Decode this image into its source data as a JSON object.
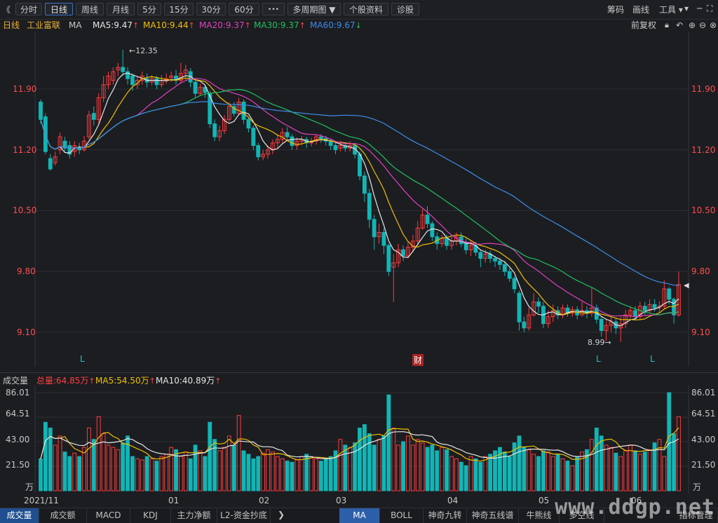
{
  "toolbar": {
    "back_glyph": "《",
    "periods": [
      "分时",
      "日线",
      "周线",
      "月线",
      "5分",
      "15分",
      "30分",
      "60分"
    ],
    "more_label": "•••",
    "multi_period_label": "多周期图 ▼",
    "stock_info_label": "个股资料",
    "diagnose_label": "诊股",
    "chip_label": "筹码",
    "draw_label": "画线",
    "tools_label": "工具 ▾",
    "pin_glyph": "▾",
    "window_glyphs": [
      "─",
      "⛶"
    ]
  },
  "ma_legend": {
    "period": "日线",
    "stock_name": "工业富联",
    "indicator": "MA",
    "items": [
      {
        "label": "MA5:9.47",
        "dir": "↑",
        "color": "#e6e6e6"
      },
      {
        "label": "MA10:9.44",
        "dir": "↑",
        "color": "#f0c000"
      },
      {
        "label": "MA20:9.37",
        "dir": "↑",
        "color": "#e040c0"
      },
      {
        "label": "MA30:9.37",
        "dir": "↑",
        "color": "#20c060"
      },
      {
        "label": "MA60:9.67",
        "dir": "↓",
        "color": "#3c8ce8"
      }
    ],
    "adjust_label": "前复权"
  },
  "price_axis": {
    "ticks": [
      "11.90",
      "11.20",
      "10.50",
      "9.80",
      "9.10"
    ]
  },
  "annotations": {
    "high": "12.35",
    "low": "8.99",
    "markers": [
      "L",
      "财",
      "L",
      "L"
    ]
  },
  "volume": {
    "title": "成交量",
    "total": "总量:64.85万",
    "ma5": "MA5:54.50万",
    "ma10": "MA10:40.89万",
    "ticks": [
      "86.01",
      "64.51",
      "43.00",
      "21.50"
    ],
    "unit": "万"
  },
  "date_axis": [
    "2021/11",
    "01",
    "02",
    "03",
    "04",
    "05",
    "06"
  ],
  "subtabs_left": [
    "成交量",
    "成交额",
    "MACD",
    "KDJ",
    "主力净额",
    "L2-资金抄底"
  ],
  "subtabs_right": [
    "MA",
    "BOLL",
    "神奇九转",
    "神奇五线谱",
    "牛熊线",
    "多空线",
    "指标管理"
  ],
  "watermark": "www.ddgp.net",
  "colors": {
    "up": "#ff3b3b",
    "down": "#12b5b5",
    "grid": "#2c2e34",
    "bg": "#1c1d21",
    "ma5": "#e6e6e6",
    "ma10": "#f0c000",
    "ma20": "#e040c0",
    "ma30": "#20c060",
    "ma60": "#3c8ce8"
  },
  "chart_data": {
    "type": "candlestick",
    "price_range": [
      8.9,
      12.4
    ],
    "volume_range": [
      0,
      86.01
    ],
    "candles": [
      [
        11.75,
        11.55,
        11.78,
        11.5
      ],
      [
        11.58,
        11.18,
        11.62,
        11.15
      ],
      [
        11.1,
        10.98,
        11.15,
        10.96
      ],
      [
        11.05,
        11.12,
        11.18,
        11.02
      ],
      [
        11.2,
        11.35,
        11.4,
        11.15
      ],
      [
        11.3,
        11.22,
        11.35,
        11.18
      ],
      [
        11.25,
        11.15,
        11.3,
        11.1
      ],
      [
        11.18,
        11.25,
        11.3,
        11.12
      ],
      [
        11.22,
        11.2,
        11.28,
        11.15
      ],
      [
        11.2,
        11.3,
        11.36,
        11.18
      ],
      [
        11.35,
        11.6,
        11.65,
        11.32
      ],
      [
        11.62,
        11.55,
        11.7,
        11.48
      ],
      [
        11.55,
        11.8,
        11.85,
        11.5
      ],
      [
        11.8,
        11.95,
        12.05,
        11.75
      ],
      [
        11.95,
        12.05,
        12.1,
        11.9
      ],
      [
        12.0,
        12.1,
        12.15,
        11.95
      ],
      [
        12.12,
        12.15,
        12.2,
        12.05
      ],
      [
        12.15,
        12.1,
        12.35,
        12.05
      ],
      [
        12.1,
        12.02,
        12.15,
        11.95
      ],
      [
        12.05,
        11.95,
        12.08,
        11.88
      ],
      [
        11.95,
        12.0,
        12.05,
        11.9
      ],
      [
        12.0,
        12.05,
        12.1,
        11.95
      ],
      [
        12.02,
        11.98,
        12.08,
        11.92
      ],
      [
        11.98,
        12.02,
        12.06,
        11.94
      ],
      [
        12.02,
        11.95,
        12.05,
        11.9
      ],
      [
        11.95,
        12.0,
        12.06,
        11.92
      ],
      [
        12.0,
        12.02,
        12.08,
        11.96
      ],
      [
        12.03,
        12.05,
        12.1,
        11.98
      ],
      [
        12.05,
        12.0,
        12.12,
        11.95
      ],
      [
        12.0,
        12.08,
        12.2,
        11.96
      ],
      [
        12.08,
        12.12,
        12.18,
        12.0
      ],
      [
        12.1,
        11.98,
        12.14,
        11.92
      ],
      [
        11.98,
        11.85,
        12.0,
        11.8
      ],
      [
        11.85,
        11.92,
        11.96,
        11.82
      ],
      [
        11.92,
        11.86,
        11.95,
        11.8
      ],
      [
        11.85,
        11.5,
        11.88,
        11.45
      ],
      [
        11.5,
        11.35,
        11.55,
        11.3
      ],
      [
        11.35,
        11.42,
        11.48,
        11.3
      ],
      [
        11.42,
        11.55,
        11.6,
        11.38
      ],
      [
        11.55,
        11.7,
        11.75,
        11.52
      ],
      [
        11.7,
        11.62,
        11.75,
        11.58
      ],
      [
        11.62,
        11.75,
        11.8,
        11.6
      ],
      [
        11.75,
        11.55,
        11.78,
        11.5
      ],
      [
        11.55,
        11.45,
        11.58,
        11.4
      ],
      [
        11.45,
        11.25,
        11.48,
        11.2
      ],
      [
        11.25,
        11.12,
        11.28,
        11.08
      ],
      [
        11.12,
        11.15,
        11.2,
        11.08
      ],
      [
        11.15,
        11.2,
        11.25,
        11.1
      ],
      [
        11.2,
        11.28,
        11.32,
        11.15
      ],
      [
        11.28,
        11.32,
        11.38,
        11.22
      ],
      [
        11.32,
        11.4,
        11.45,
        11.28
      ],
      [
        11.4,
        11.35,
        11.46,
        11.3
      ],
      [
        11.35,
        11.25,
        11.38,
        11.2
      ],
      [
        11.25,
        11.3,
        11.34,
        11.2
      ],
      [
        11.3,
        11.32,
        11.36,
        11.25
      ],
      [
        11.32,
        11.28,
        11.35,
        11.22
      ],
      [
        11.28,
        11.3,
        11.34,
        11.24
      ],
      [
        11.3,
        11.35,
        11.38,
        11.26
      ],
      [
        11.35,
        11.33,
        11.38,
        11.28
      ],
      [
        11.33,
        11.3,
        11.36,
        11.25
      ],
      [
        11.3,
        11.25,
        11.33,
        11.2
      ],
      [
        11.25,
        11.2,
        11.28,
        11.15
      ],
      [
        11.22,
        11.25,
        11.3,
        11.18
      ],
      [
        11.25,
        11.22,
        11.28,
        11.18
      ],
      [
        11.22,
        11.25,
        11.3,
        11.18
      ],
      [
        11.25,
        11.15,
        11.28,
        11.1
      ],
      [
        11.15,
        10.9,
        11.18,
        10.85
      ],
      [
        10.9,
        10.7,
        10.95,
        10.6
      ],
      [
        10.7,
        10.4,
        10.75,
        10.3
      ],
      [
        10.4,
        10.2,
        10.45,
        10.05
      ],
      [
        10.2,
        10.25,
        10.35,
        10.12
      ],
      [
        10.25,
        10.1,
        10.3,
        10.0
      ],
      [
        10.1,
        9.8,
        10.12,
        9.75
      ],
      [
        9.85,
        9.9,
        10.0,
        9.45
      ],
      [
        9.9,
        10.05,
        10.12,
        9.85
      ],
      [
        10.05,
        9.98,
        10.1,
        9.92
      ],
      [
        9.98,
        10.08,
        10.15,
        9.95
      ],
      [
        10.08,
        10.15,
        10.22,
        10.02
      ],
      [
        10.15,
        10.3,
        10.38,
        10.1
      ],
      [
        10.3,
        10.45,
        10.52,
        10.28
      ],
      [
        10.45,
        10.35,
        10.55,
        10.3
      ],
      [
        10.35,
        10.2,
        10.38,
        10.15
      ],
      [
        10.2,
        10.12,
        10.25,
        10.05
      ],
      [
        10.12,
        10.18,
        10.22,
        10.08
      ],
      [
        10.18,
        10.1,
        10.22,
        10.05
      ],
      [
        10.1,
        10.15,
        10.2,
        10.05
      ],
      [
        10.15,
        10.2,
        10.25,
        10.1
      ],
      [
        10.2,
        10.12,
        10.25,
        10.08
      ],
      [
        10.12,
        10.05,
        10.18,
        10.0
      ],
      [
        10.05,
        10.1,
        10.15,
        9.98
      ],
      [
        10.1,
        10.02,
        10.14,
        9.98
      ],
      [
        10.02,
        9.95,
        10.05,
        9.85
      ],
      [
        9.95,
        10.0,
        10.05,
        9.9
      ],
      [
        10.0,
        9.95,
        10.04,
        9.9
      ],
      [
        9.95,
        9.92,
        9.98,
        9.85
      ],
      [
        9.92,
        9.88,
        9.96,
        9.82
      ],
      [
        9.88,
        9.8,
        9.92,
        9.75
      ],
      [
        9.8,
        9.72,
        9.84,
        9.68
      ],
      [
        9.72,
        9.6,
        9.75,
        9.55
      ],
      [
        9.55,
        9.22,
        9.58,
        9.12
      ],
      [
        9.22,
        9.15,
        9.28,
        9.1
      ],
      [
        9.15,
        9.3,
        9.38,
        9.12
      ],
      [
        9.3,
        9.45,
        9.55,
        9.28
      ],
      [
        9.45,
        9.4,
        9.5,
        9.32
      ],
      [
        9.4,
        9.2,
        9.45,
        9.15
      ],
      [
        9.2,
        9.28,
        9.35,
        9.15
      ],
      [
        9.28,
        9.35,
        9.42,
        9.22
      ],
      [
        9.35,
        9.3,
        9.4,
        9.25
      ],
      [
        9.3,
        9.38,
        9.42,
        9.26
      ],
      [
        9.38,
        9.32,
        9.42,
        9.28
      ],
      [
        9.32,
        9.36,
        9.4,
        9.28
      ],
      [
        9.36,
        9.3,
        9.4,
        9.25
      ],
      [
        9.3,
        9.35,
        9.45,
        9.28
      ],
      [
        9.35,
        9.32,
        9.4,
        9.26
      ],
      [
        9.32,
        9.38,
        9.62,
        9.28
      ],
      [
        9.38,
        9.25,
        9.42,
        9.2
      ],
      [
        9.25,
        9.12,
        9.28,
        9.05
      ],
      [
        9.12,
        9.18,
        9.24,
        9.0
      ],
      [
        9.18,
        9.22,
        9.28,
        9.1
      ],
      [
        9.22,
        9.15,
        9.26,
        9.08
      ],
      [
        9.15,
        9.2,
        9.28,
        8.99
      ],
      [
        9.2,
        9.3,
        9.36,
        9.15
      ],
      [
        9.3,
        9.35,
        9.4,
        9.26
      ],
      [
        9.35,
        9.28,
        9.4,
        9.24
      ],
      [
        9.28,
        9.4,
        9.45,
        9.25
      ],
      [
        9.4,
        9.35,
        9.45,
        9.3
      ],
      [
        9.35,
        9.42,
        9.48,
        9.32
      ],
      [
        9.42,
        9.38,
        9.48,
        9.34
      ],
      [
        9.38,
        9.4,
        9.46,
        9.32
      ],
      [
        9.4,
        9.6,
        9.7,
        9.36
      ],
      [
        9.6,
        9.48,
        9.62,
        9.42
      ],
      [
        9.48,
        9.3,
        9.5,
        9.2
      ],
      [
        9.3,
        9.65,
        9.8,
        9.28
      ]
    ],
    "volumes": [
      28,
      60,
      55,
      40,
      48,
      34,
      30,
      33,
      30,
      38,
      55,
      45,
      65,
      50,
      40,
      38,
      36,
      42,
      48,
      30,
      28,
      27,
      30,
      28,
      26,
      30,
      32,
      38,
      36,
      30,
      34,
      28,
      40,
      35,
      30,
      60,
      45,
      35,
      38,
      48,
      40,
      66,
      35,
      32,
      28,
      30,
      33,
      36,
      34,
      30,
      28,
      26,
      25,
      27,
      30,
      32,
      30,
      28,
      26,
      28,
      30,
      35,
      45,
      40,
      38,
      42,
      55,
      58,
      50,
      40,
      45,
      48,
      84,
      55,
      40,
      43,
      48,
      40,
      45,
      42,
      38,
      40,
      35,
      38,
      36,
      30,
      28,
      25,
      22,
      30,
      28,
      25,
      30,
      32,
      35,
      38,
      34,
      30,
      42,
      48,
      38,
      36,
      32,
      30,
      35,
      34,
      30,
      32,
      28,
      26,
      22,
      30,
      34,
      36,
      45,
      55,
      48,
      40,
      38,
      33,
      30,
      35,
      40,
      35,
      32,
      34,
      36,
      42,
      45,
      30,
      86,
      50,
      64.85
    ]
  }
}
